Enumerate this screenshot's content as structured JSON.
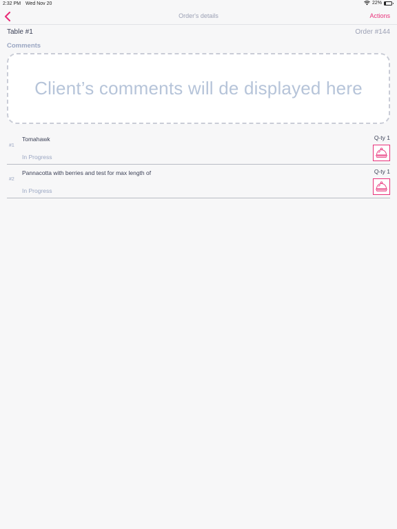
{
  "status_bar": {
    "time": "2:32 PM",
    "date": "Wed Nov 20",
    "battery_text": "22%",
    "battery_level": 0.22
  },
  "nav": {
    "title": "Order's details",
    "actions_label": "Actions",
    "back_icon": "chevron-left-icon"
  },
  "order": {
    "table_label": "Table #1",
    "order_number": "Order #144"
  },
  "comments": {
    "label": "Comments",
    "placeholder": "Client’s comments will de displayed here"
  },
  "items": [
    {
      "index": "#1",
      "name": "Tomahawk",
      "status": "In Progress",
      "qty": "Q-ty 1",
      "icon": "cloche-icon"
    },
    {
      "index": "#2",
      "name": "Pannacotta with berries and test for max length of",
      "status": "In Progress",
      "qty": "Q-ty 1",
      "icon": "cloche-icon"
    }
  ],
  "colors": {
    "accent": "#e8317a",
    "muted_text": "#9ba0b4",
    "placeholder": "#b6c4d9",
    "background": "#f7f7f8"
  }
}
